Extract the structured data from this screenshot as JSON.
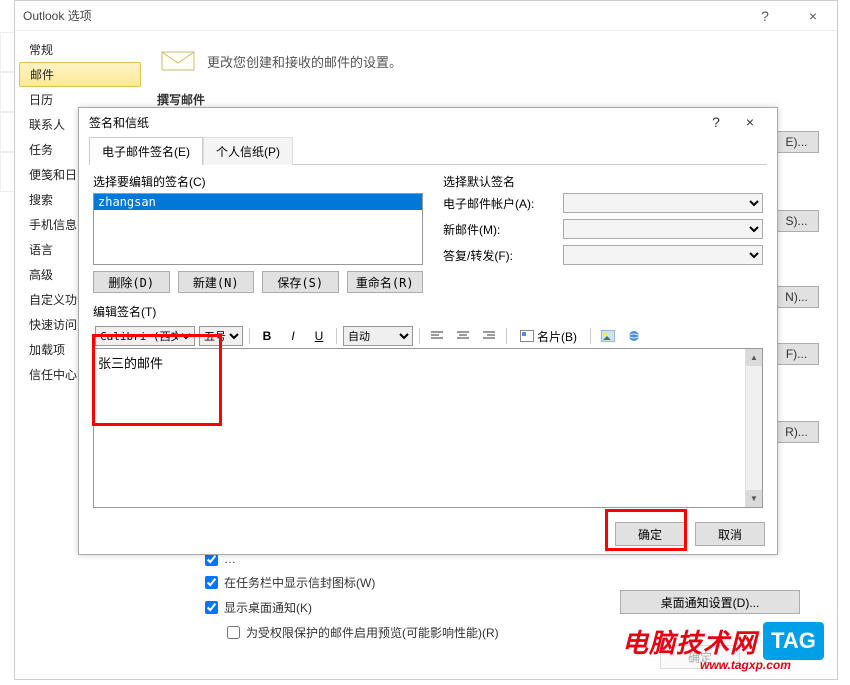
{
  "window": {
    "title": "Outlook 选项",
    "help": "?",
    "close": "×"
  },
  "sidebar": {
    "items": [
      "常规",
      "邮件",
      "日历",
      "联系人",
      "任务",
      "便笺和日",
      "搜索",
      "手机信息",
      "语言",
      "高级",
      "自定义功",
      "快速访问",
      "加载项",
      "信任中心"
    ],
    "selected_index": 1
  },
  "main": {
    "header_text": "更改您创建和接收的邮件的设置。",
    "section": "撰写邮件",
    "right_buttons": [
      "E)...",
      "S)...",
      "N)...",
      "F)...",
      "R)..."
    ],
    "checkboxes": {
      "cb1": "…",
      "cb2": "在任务栏中显示信封图标(W)",
      "cb3": "显示桌面通知(K)",
      "cb4": "为受权限保护的邮件启用预览(可能影响性能)(R)"
    },
    "desktop_notif_btn": "桌面通知设置(D)...",
    "faded_ok": "确定"
  },
  "sig_dialog": {
    "title": "签名和信纸",
    "help": "?",
    "close": "×",
    "tabs": [
      "电子邮件签名(E)",
      "个人信纸(P)"
    ],
    "active_tab": 0,
    "select_label": "选择要编辑的签名(C)",
    "list_item": "zhangsan",
    "default_label": "选择默认签名",
    "account_label": "电子邮件帐户(A):",
    "newmail_label": "新邮件(M):",
    "reply_label": "答复/转发(F):",
    "buttons": {
      "delete": "删除(D)",
      "new": "新建(N)",
      "save": "保存(S)",
      "rename": "重命名(R)"
    },
    "edit_label": "编辑签名(T)",
    "toolbar": {
      "font": "Calibri (西文]",
      "size": "五号",
      "auto": "自动",
      "business_card": "名片(B)"
    },
    "editor_text": "张三的邮件",
    "ok": "确定",
    "cancel": "取消"
  },
  "logo": {
    "text": "电脑技术网",
    "tag": "TAG",
    "url": "www.tagxp.com"
  }
}
